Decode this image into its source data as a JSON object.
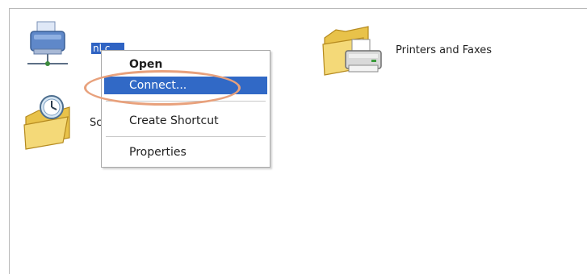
{
  "desktop": {
    "items": [
      {
        "label": "nl.c....",
        "icon": "network-printer-icon",
        "selected": true
      },
      {
        "label": "Sc",
        "icon": "scheduled-tasks-folder-icon",
        "selected": false
      },
      {
        "label": "Printers and Faxes",
        "icon": "printers-and-faxes-folder-icon",
        "selected": false
      }
    ]
  },
  "context_menu": {
    "items": [
      {
        "label": "Open",
        "bold": true
      },
      {
        "label": "Connect...",
        "highlighted": true
      },
      {
        "label": "Create Shortcut"
      },
      {
        "label": "Properties"
      }
    ]
  },
  "colors": {
    "selection": "#3169c6",
    "annotation": "#e8a17c"
  }
}
